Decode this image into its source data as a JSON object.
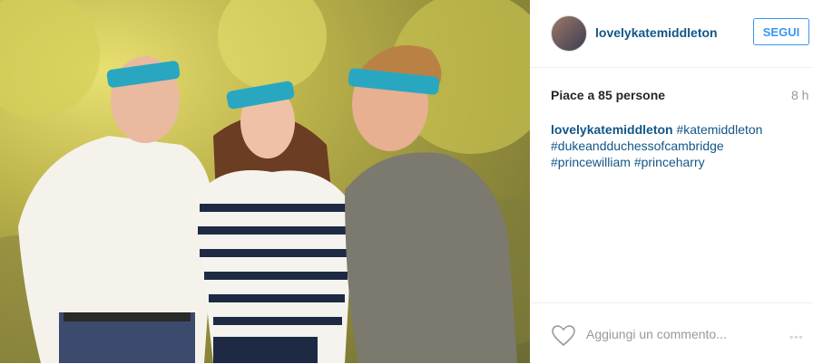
{
  "post": {
    "username": "lovelykatemiddleton",
    "follow_label": "SEGUI",
    "likes_text": "Piace a 85 persone",
    "time_text": "8 h",
    "caption_user": "lovelykatemiddleton",
    "hashtags": [
      "#katemiddleton",
      "#dukeandduchessofcambridge",
      "#princewilliam",
      "#princeharry"
    ],
    "comment_placeholder": "Aggiungi un commento...",
    "more_label": "◦◦◦"
  },
  "icons": {
    "heart": "heart-icon",
    "more": "more-options-icon"
  },
  "colors": {
    "link": "#125688",
    "follow": "#3897f0",
    "headband": "#2aa7c0"
  }
}
